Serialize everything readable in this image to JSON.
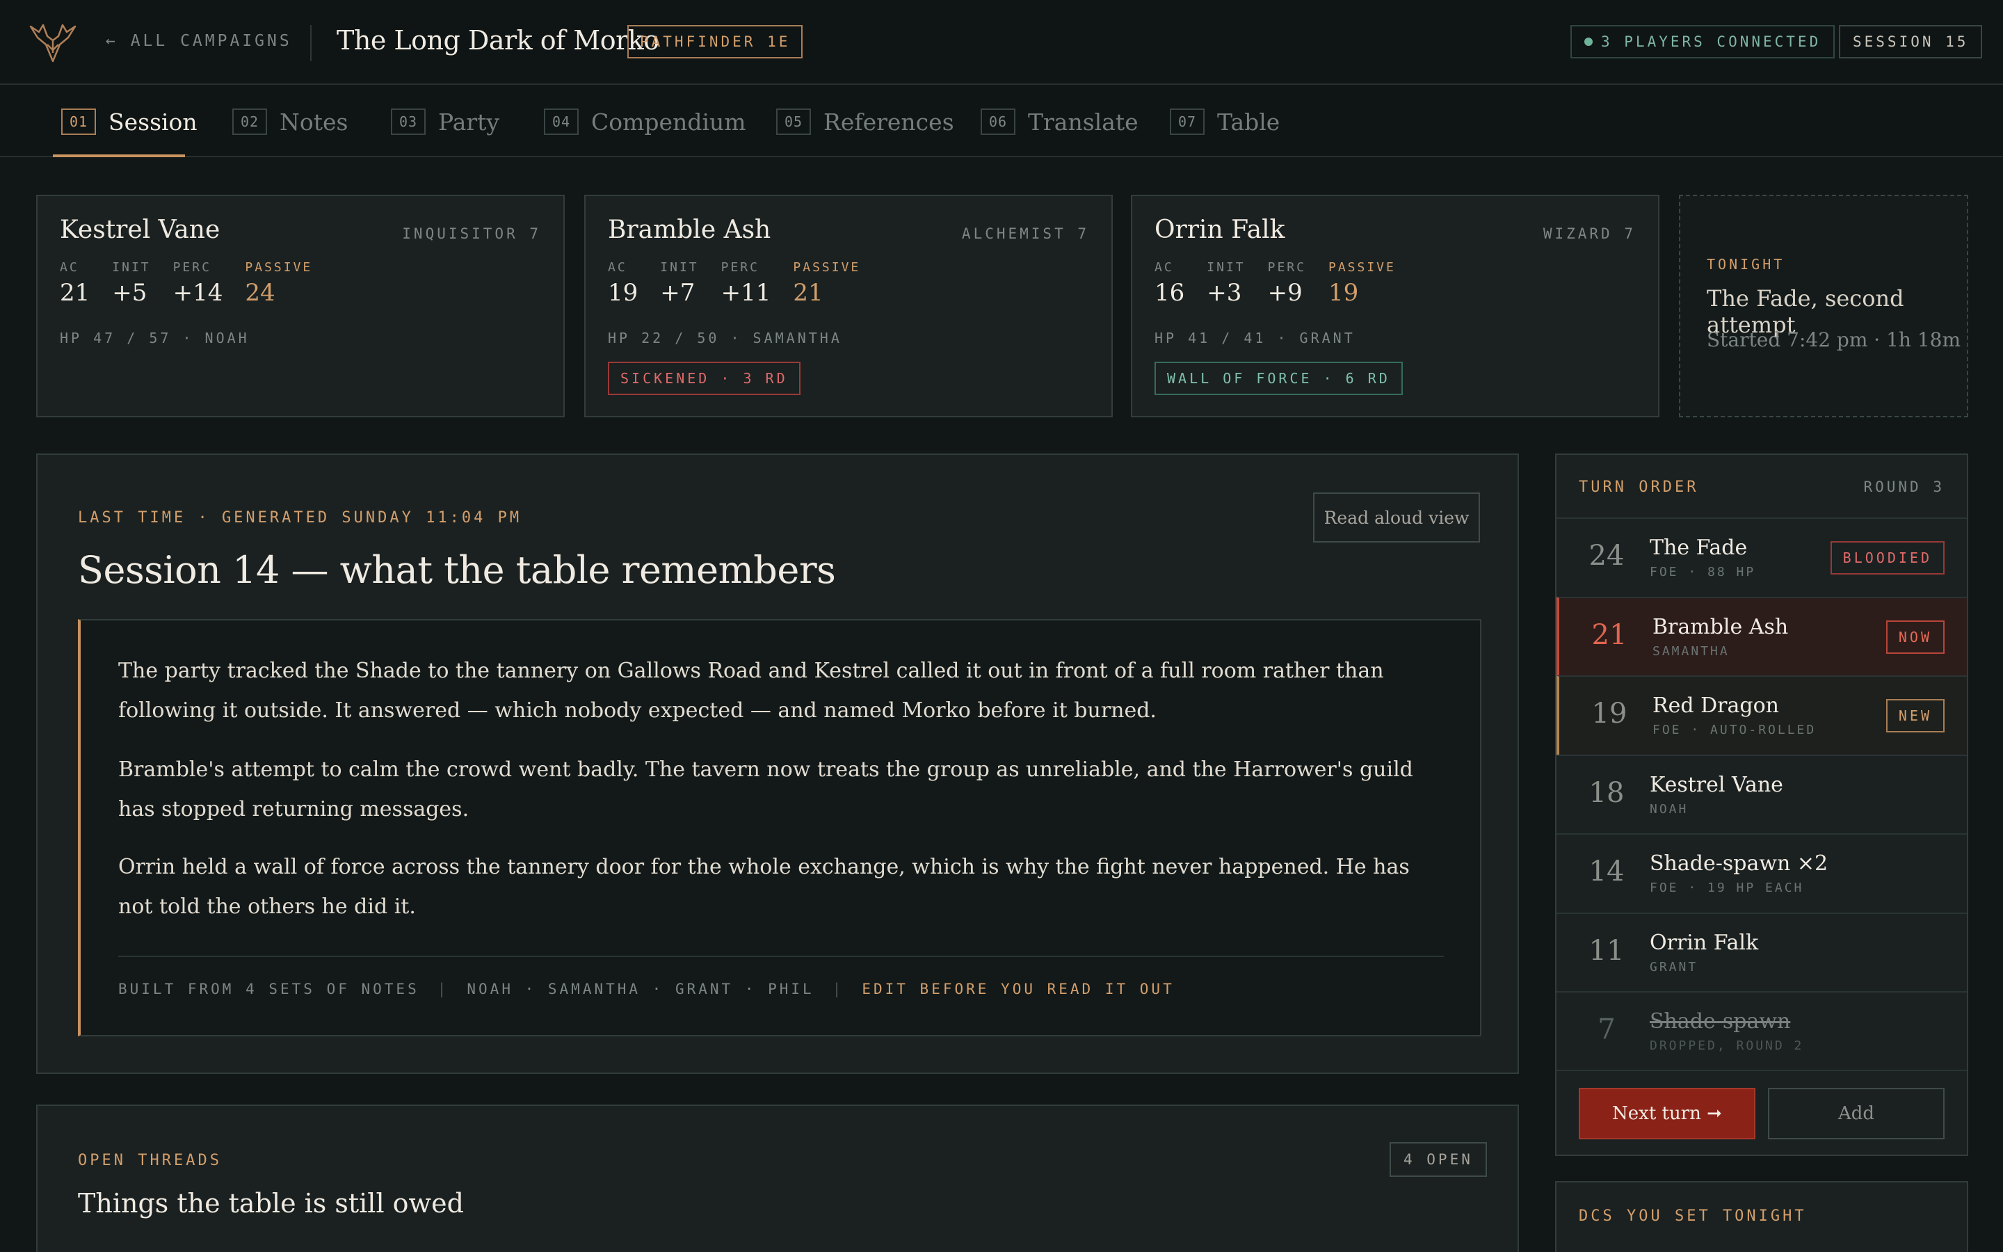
{
  "header": {
    "back_label": "← ALL CAMPAIGNS",
    "title": "The Long Dark of Morko",
    "system_badge": "PATHFINDER 1E",
    "players_connected": "3 PLAYERS CONNECTED",
    "session_label": "SESSION 15"
  },
  "tabs": [
    {
      "num": "01",
      "label": "Session"
    },
    {
      "num": "02",
      "label": "Notes"
    },
    {
      "num": "03",
      "label": "Party"
    },
    {
      "num": "04",
      "label": "Compendium"
    },
    {
      "num": "05",
      "label": "References"
    },
    {
      "num": "06",
      "label": "Translate"
    },
    {
      "num": "07",
      "label": "Table"
    }
  ],
  "stat_labels": {
    "ac": "AC",
    "init": "INIT",
    "perc": "PERC",
    "passive": "PASSIVE"
  },
  "characters": [
    {
      "name": "Kestrel Vane",
      "class": "INQUISITOR 7",
      "ac": "21",
      "init": "+5",
      "perc": "+14",
      "passive": "24",
      "hp": "HP 47 / 57 · NOAH",
      "condition": ""
    },
    {
      "name": "Bramble Ash",
      "class": "ALCHEMIST 7",
      "ac": "19",
      "init": "+7",
      "perc": "+11",
      "passive": "21",
      "hp": "HP 22 / 50 · SAMANTHA",
      "condition": "SICKENED · 3 RD"
    },
    {
      "name": "Orrin Falk",
      "class": "WIZARD 7",
      "ac": "16",
      "init": "+3",
      "perc": "+9",
      "passive": "19",
      "hp": "HP 41 / 41 · GRANT",
      "condition": "WALL OF FORCE · 6 RD"
    }
  ],
  "tonight": {
    "label": "TONIGHT",
    "title": "The Fade, second attempt",
    "started": "Started 7:42 pm · 1h 18m"
  },
  "recap": {
    "label": "LAST TIME · GENERATED SUNDAY 11:04 PM",
    "read_aloud": "Read aloud view",
    "title": "Session 14 — what the table remembers",
    "paragraphs": [
      "The party tracked the Shade to the tannery on Gallows Road and Kestrel called it out in front of a full room rather than following it outside. It answered — which nobody expected — and named Morko before it burned.",
      "Bramble's attempt to calm the crowd went badly. The tavern now treats the group as unreliable, and the Harrower's guild has stopped returning messages.",
      "Orrin held a wall of force across the tannery door for the whole exchange, which is why the fight never happened. He has not told the others he did it."
    ],
    "built_from": "BUILT FROM 4 SETS OF NOTES",
    "sep": "|",
    "authors": "NOAH · SAMANTHA · GRANT · PHIL",
    "edit": "EDIT BEFORE YOU READ IT OUT"
  },
  "threads": {
    "label": "OPEN THREADS",
    "count": "4 OPEN",
    "title": "Things the table is still owed"
  },
  "turn_order": {
    "label": "TURN ORDER",
    "round": "ROUND 3",
    "rows": [
      {
        "init": "24",
        "name": "The Fade",
        "sub": "FOE · 88 HP",
        "tag": "BLOODIED"
      },
      {
        "init": "21",
        "name": "Bramble Ash",
        "sub": "SAMANTHA",
        "tag": "NOW"
      },
      {
        "init": "19",
        "name": "Red Dragon",
        "sub": "FOE · AUTO-ROLLED",
        "tag": "NEW"
      },
      {
        "init": "18",
        "name": "Kestrel Vane",
        "sub": "NOAH",
        "tag": ""
      },
      {
        "init": "14",
        "name": "Shade-spawn ×2",
        "sub": "FOE · 19 HP EACH",
        "tag": ""
      },
      {
        "init": "11",
        "name": "Orrin Falk",
        "sub": "GRANT",
        "tag": ""
      },
      {
        "init": "7",
        "name": "Shade-spawn",
        "sub": "DROPPED, ROUND 2",
        "tag": ""
      }
    ],
    "next_turn": "Next turn ➞",
    "add": "Add"
  },
  "dcs": {
    "label": "DCS YOU SET TONIGHT"
  },
  "colors": {
    "accent": "#d39f6c",
    "danger": "#e06a6a",
    "ok": "#7fc0ab",
    "bg": "#111616"
  }
}
